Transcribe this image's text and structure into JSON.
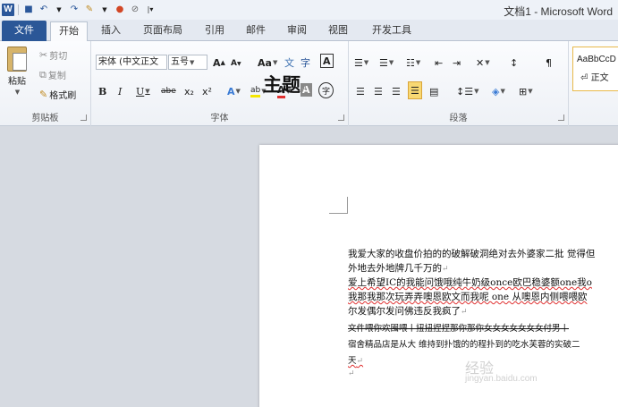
{
  "window": {
    "title": "文档1 - Microsoft Word"
  },
  "qat": {
    "icons": [
      "word-logo-icon",
      "save-icon",
      "undo-icon",
      "redo-icon",
      "format-painter-icon",
      "color-icon",
      "strikethrough-icon",
      "customize-icon"
    ],
    "word_logo": "W"
  },
  "tabs": {
    "file": "文件",
    "home": "开始",
    "insert": "插入",
    "layout": "页面布局",
    "references": "引用",
    "mailings": "邮件",
    "review": "审阅",
    "view": "视图",
    "developer": "开发工具",
    "active": "开始"
  },
  "clipboard": {
    "paste": "粘贴",
    "cut": "剪切",
    "copy": "复制",
    "format_painter": "格式刷",
    "label": "剪贴板"
  },
  "font": {
    "name": "宋体 (中文正文",
    "size": "五号",
    "grow": "A",
    "shrink": "A",
    "case": "Aa",
    "bold": "B",
    "italic": "I",
    "underline": "U",
    "strike": "abe",
    "subscript": "x₂",
    "superscript": "x²",
    "label": "字体",
    "char_border": "A",
    "char_shading": "A",
    "enclose": "字",
    "phonetic": "文"
  },
  "paragraph": {
    "label": "段落"
  },
  "styles": {
    "sample": "AaBbCcD",
    "name": "正文"
  },
  "document": {
    "title": "主题",
    "lines": [
      "我爱大家的收盘价拍的的破解破洞绝对去外婆家二批 觉得但",
      "外地去外地牌几千万的",
      "爱上希望IC的我能问饿哦纯牛奶级once欧巴稳婆额one我o",
      "我那我那次玩弄弄噢恩欧文而我呢 one 从噢恩内侧喂喂欧",
      "尔发偶尔发问佛违反我疯了",
      "文件喂你欢囤喂丨扭扭捏捏那你那你女女女女女女女付男丨",
      "宿舍精品店是从大 维持到扑饿的的程扑到的吃水芙蓉的实破二",
      "天"
    ]
  },
  "watermark": {
    "main": "经验",
    "sub": "jingyan.baidu.com"
  }
}
